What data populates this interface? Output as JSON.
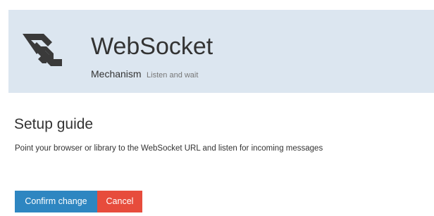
{
  "header": {
    "logo_icon": "websocket-logo-icon",
    "title": "WebSocket",
    "mechanism_label": "Mechanism",
    "mechanism_value": "Listen and wait",
    "background_color": "#dce6f0"
  },
  "guide": {
    "title": "Setup guide",
    "description": "Point your browser or library to the WebSocket URL and listen for incoming messages"
  },
  "actions": {
    "confirm_label": "Confirm change",
    "cancel_label": "Cancel",
    "confirm_color": "#2e86c1",
    "cancel_color": "#e74c3c"
  }
}
